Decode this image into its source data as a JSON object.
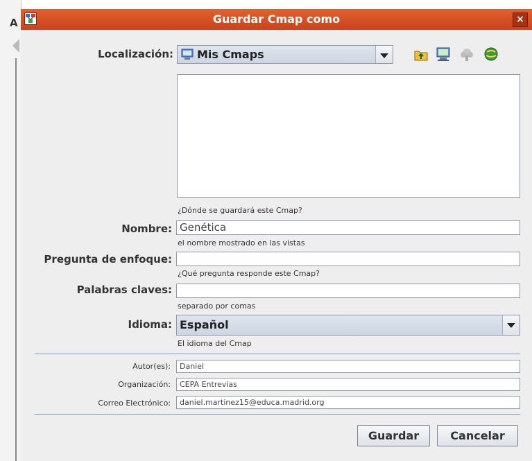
{
  "window": {
    "title": "Guardar Cmap como",
    "close_glyph": "×",
    "app_icon": "cmap-app-icon",
    "background_letter": "A"
  },
  "location": {
    "label": "Localización:",
    "selected": "Mis Cmaps",
    "hint": "¿Dónde se guardará este Cmap?",
    "toolbar_icons": [
      "folder-up-icon",
      "my-cmaps-icon",
      "shared-sites-icon",
      "places-icon"
    ]
  },
  "name": {
    "label": "Nombre:",
    "value": "Genética",
    "hint": "el nombre mostrado en las vistas"
  },
  "focus_question": {
    "label": "Pregunta de enfoque:",
    "value": "",
    "hint": "¿Qué pregunta responde este Cmap?"
  },
  "keywords": {
    "label": "Palabras claves:",
    "value": "",
    "hint": "separado por comas"
  },
  "language": {
    "label": "Idioma:",
    "selected": "Español",
    "hint": "El idioma del Cmap"
  },
  "author": {
    "label": "Autor(es):",
    "value": "Daniel"
  },
  "organization": {
    "label": "Organización:",
    "value": "CEPA Entrevías"
  },
  "email": {
    "label": "Correo Electrónico:",
    "value": "daniel.martinez15@educa.madrid.org"
  },
  "buttons": {
    "save": "Guardar",
    "cancel": "Cancelar"
  }
}
